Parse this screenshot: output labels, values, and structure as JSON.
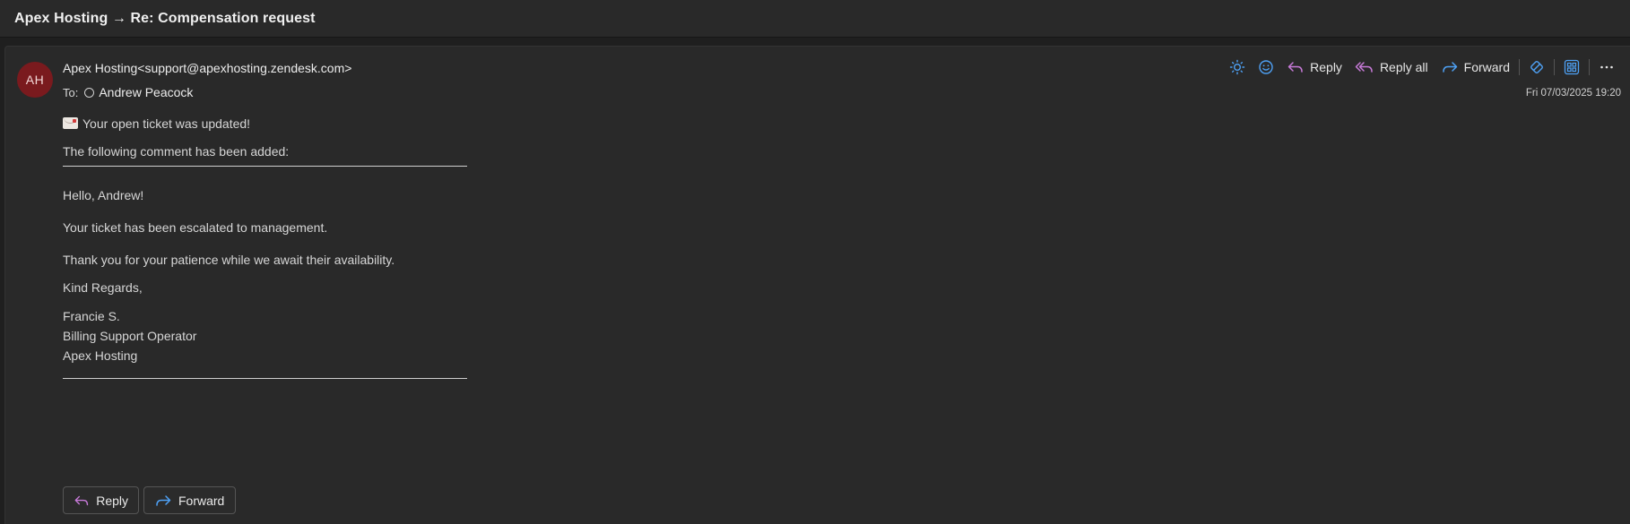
{
  "window": {
    "title": "Apex Hosting → Re: Compensation request"
  },
  "message": {
    "avatar_initials": "AH",
    "avatar_color": "#7a1a1e",
    "from": "Apex Hosting<support@apexhosting.zendesk.com>",
    "to_label": "To:",
    "to_recipient": "Andrew Peacock",
    "date": "Fri 07/03/2025 19:20"
  },
  "toolbar": {
    "brightness_icon": "sun-icon",
    "emoji_icon": "smiley-icon",
    "reply_label": "Reply",
    "reply_all_label": "Reply all",
    "forward_label": "Forward",
    "more_icon": "ellipsis-icon"
  },
  "body": {
    "line_updated": "Your open ticket was updated!",
    "line_comment_added": "The following comment has been added:",
    "greeting": "Hello, Andrew!",
    "line_escalated": "Your ticket has been escalated to management.",
    "line_thanks": "Thank you for your patience while we await their availability.",
    "closing": "Kind Regards,",
    "sig_name": "Francie S.",
    "sig_role": "Billing Support Operator",
    "sig_company": "Apex Hosting"
  },
  "bottom_actions": {
    "reply_label": "Reply",
    "forward_label": "Forward"
  },
  "colors": {
    "reply_icon": "#c77ad8",
    "forward_icon": "#4ea1f5",
    "accent_blue": "#4ea1f5"
  }
}
